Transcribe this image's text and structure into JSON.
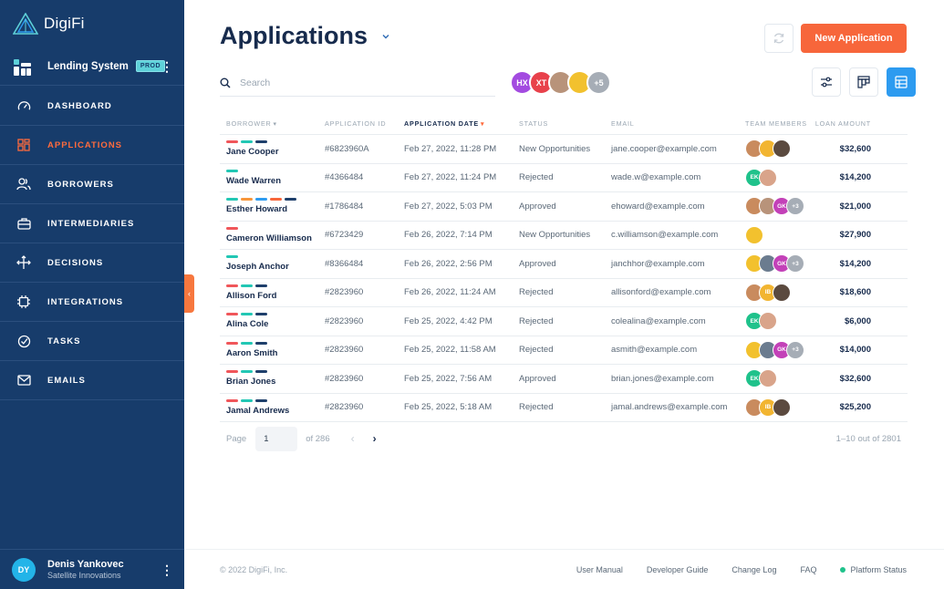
{
  "app": {
    "logo_text": "DigiFi"
  },
  "org": {
    "name": "Lending System",
    "badge": "PROD"
  },
  "nav": [
    {
      "label": "DASHBOARD",
      "icon": "gauge-icon",
      "active": false
    },
    {
      "label": "APPLICATIONS",
      "icon": "grid-icon",
      "active": true
    },
    {
      "label": "BORROWERS",
      "icon": "people-icon",
      "active": false
    },
    {
      "label": "INTERMEDIARIES",
      "icon": "briefcase-icon",
      "active": false
    },
    {
      "label": "DECISIONS",
      "icon": "split-arrows-icon",
      "active": false
    },
    {
      "label": "INTEGRATIONS",
      "icon": "chip-icon",
      "active": false
    },
    {
      "label": "TASKS",
      "icon": "check-circle-icon",
      "active": false
    },
    {
      "label": "EMAILS",
      "icon": "envelope-icon",
      "active": false
    }
  ],
  "user": {
    "initials": "DY",
    "name": "Denis Yankovec",
    "company": "Satellite Innovations"
  },
  "page": {
    "title": "Applications"
  },
  "toolbar": {
    "new_label": "New Application",
    "search_placeholder": "Search"
  },
  "member_filter": {
    "avatars": [
      {
        "initials": "HX",
        "color": "#a34be0"
      },
      {
        "initials": "XT",
        "color": "#e8414b"
      },
      {
        "initials": "",
        "color": "#b8937a"
      },
      {
        "initials": "",
        "color": "#f2c12e"
      },
      {
        "initials": "+5",
        "color": "#a6adb6"
      }
    ]
  },
  "colors": {
    "accent": "#f7663b",
    "sidebar": "#173c6b",
    "active_view": "#2d9bf0"
  },
  "table": {
    "columns": [
      "BORROWER",
      "APPLICATION ID",
      "APPLICATION DATE",
      "STATUS",
      "EMAIL",
      "TEAM MEMBERS",
      "LOAN AMOUNT"
    ],
    "sort_column": "APPLICATION DATE",
    "rows": [
      {
        "tags": [
          "#f0565a",
          "#22c7b4",
          "#1e3f6b"
        ],
        "borrower": "Jane Cooper",
        "id": "#6823960A",
        "date": "Feb 27, 2022, 11:28 PM",
        "status": "New Opportunities",
        "email": "jane.cooper@example.com",
        "team": [
          {
            "i": "",
            "c": "#c98b5e"
          },
          {
            "i": "",
            "c": "#f2b531"
          },
          {
            "i": "",
            "c": "#5b4a3f"
          }
        ],
        "amount": "$32,600"
      },
      {
        "tags": [
          "#22c7b4"
        ],
        "borrower": "Wade Warren",
        "id": "#4366484",
        "date": "Feb 27, 2022, 11:24 PM",
        "status": "Rejected",
        "email": "wade.w@example.com",
        "team": [
          {
            "i": "EK",
            "c": "#1fc28b"
          },
          {
            "i": "",
            "c": "#d9a48a"
          }
        ],
        "amount": "$14,200"
      },
      {
        "tags": [
          "#22c7b4",
          "#f7963b",
          "#2d9bf0",
          "#f7663b",
          "#1e3f6b"
        ],
        "borrower": "Esther Howard",
        "id": "#1786484",
        "date": "Feb 27, 2022, 5:03 PM",
        "status": "Approved",
        "email": "ehoward@example.com",
        "team": [
          {
            "i": "",
            "c": "#c98b5e"
          },
          {
            "i": "",
            "c": "#b8937a"
          },
          {
            "i": "GK",
            "c": "#c341b8"
          },
          {
            "i": "+3",
            "c": "#a6adb6"
          }
        ],
        "amount": "$21,000"
      },
      {
        "tags": [
          "#f0565a"
        ],
        "borrower": "Cameron Williamson",
        "id": "#6723429",
        "date": "Feb 26, 2022, 7:14 PM",
        "status": "New Opportunities",
        "email": "c.williamson@example.com",
        "team": [
          {
            "i": "",
            "c": "#f2c12e"
          }
        ],
        "amount": "$27,900"
      },
      {
        "tags": [
          "#22c7b4"
        ],
        "borrower": "Joseph Anchor",
        "id": "#8366484",
        "date": "Feb 26, 2022, 2:56 PM",
        "status": "Approved",
        "email": "janchhor@example.com",
        "team": [
          {
            "i": "",
            "c": "#f2c12e"
          },
          {
            "i": "",
            "c": "#6b7c8f"
          },
          {
            "i": "GK",
            "c": "#c341b8"
          },
          {
            "i": "+3",
            "c": "#a6adb6"
          }
        ],
        "amount": "$14,200"
      },
      {
        "tags": [
          "#f0565a",
          "#22c7b4",
          "#1e3f6b"
        ],
        "borrower": "Allison Ford",
        "id": "#2823960",
        "date": "Feb 26, 2022, 11:24 AM",
        "status": "Rejected",
        "email": "allisonford@example.com",
        "team": [
          {
            "i": "",
            "c": "#c98b5e"
          },
          {
            "i": "IB",
            "c": "#f2b531"
          },
          {
            "i": "",
            "c": "#5b4a3f"
          }
        ],
        "amount": "$18,600"
      },
      {
        "tags": [
          "#f0565a",
          "#22c7b4",
          "#1e3f6b"
        ],
        "borrower": "Alina Cole",
        "id": "#2823960",
        "date": "Feb 25, 2022, 4:42 PM",
        "status": "Rejected",
        "email": "colealina@example.com",
        "team": [
          {
            "i": "EK",
            "c": "#1fc28b"
          },
          {
            "i": "",
            "c": "#d9a48a"
          }
        ],
        "amount": "$6,000"
      },
      {
        "tags": [
          "#f0565a",
          "#22c7b4",
          "#1e3f6b"
        ],
        "borrower": "Aaron Smith",
        "id": "#2823960",
        "date": "Feb 25, 2022, 11:58 AM",
        "status": "Rejected",
        "email": "asmith@example.com",
        "team": [
          {
            "i": "",
            "c": "#f2c12e"
          },
          {
            "i": "",
            "c": "#6b7c8f"
          },
          {
            "i": "GK",
            "c": "#c341b8"
          },
          {
            "i": "+3",
            "c": "#a6adb6"
          }
        ],
        "amount": "$14,000"
      },
      {
        "tags": [
          "#f0565a",
          "#22c7b4",
          "#1e3f6b"
        ],
        "borrower": "Brian Jones",
        "id": "#2823960",
        "date": "Feb 25, 2022, 7:56 AM",
        "status": "Approved",
        "email": "brian.jones@example.com",
        "team": [
          {
            "i": "EK",
            "c": "#1fc28b"
          },
          {
            "i": "",
            "c": "#d9a48a"
          }
        ],
        "amount": "$32,600"
      },
      {
        "tags": [
          "#f0565a",
          "#22c7b4",
          "#1e3f6b"
        ],
        "borrower": "Jamal Andrews",
        "id": "#2823960",
        "date": "Feb 25, 2022, 5:18 AM",
        "status": "Rejected",
        "email": "jamal.andrews@example.com",
        "team": [
          {
            "i": "",
            "c": "#c98b5e"
          },
          {
            "i": "IB",
            "c": "#f2b531"
          },
          {
            "i": "",
            "c": "#5b4a3f"
          }
        ],
        "amount": "$25,200"
      }
    ]
  },
  "pager": {
    "label": "Page",
    "current": "1",
    "of": "of 286",
    "range": "1–10 out of 2801"
  },
  "footer": {
    "copyright": "© 2022 DigiFi, Inc.",
    "links": [
      "User Manual",
      "Developer Guide",
      "Change Log",
      "FAQ"
    ],
    "status_label": "Platform Status"
  }
}
